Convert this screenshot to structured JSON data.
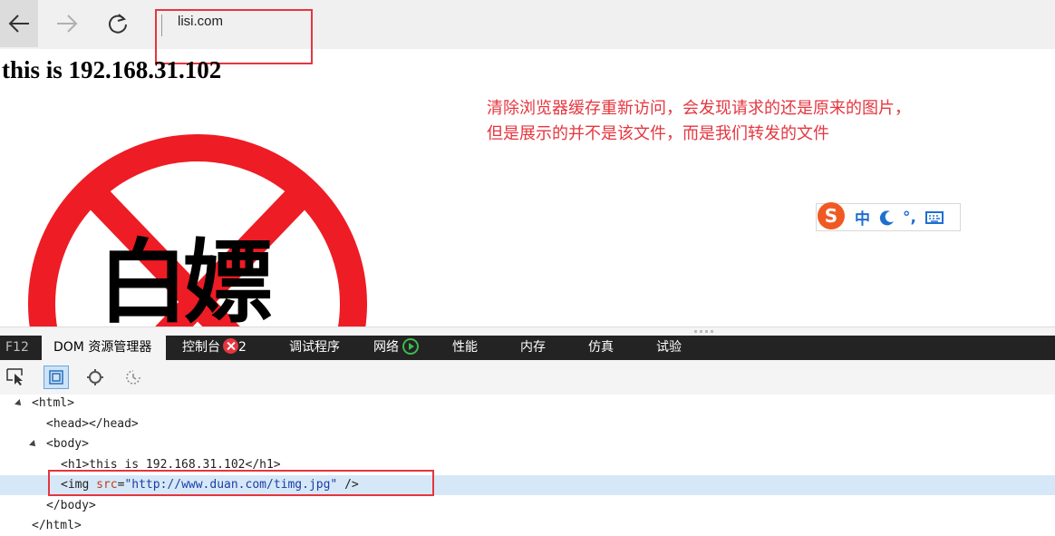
{
  "browser": {
    "url": "lisi.com"
  },
  "page": {
    "heading": "this is 192.168.31.102",
    "sign_text": "白嫖"
  },
  "annotation": {
    "line1": "清除浏览器缓存重新访问，会发现请求的还是原来的图片，",
    "line2": "但是展示的并不是该文件，而是我们转发的文件"
  },
  "ime": {
    "lang": "中",
    "punct": "°,"
  },
  "devtools": {
    "tabs": {
      "f12": "F12",
      "dom": "DOM 资源管理器",
      "console": "控制台",
      "console_errors": "2",
      "debugger": "调试程序",
      "network": "网络",
      "performance": "性能",
      "memory": "内存",
      "emulation": "仿真",
      "experiments": "试验"
    },
    "tree": {
      "html_open": "<html>",
      "head": "<head></head>",
      "body_open": "<body>",
      "h1": "<h1>this is 192.168.31.102</h1>",
      "img_open": "<img ",
      "img_attr_name": "src",
      "img_eq": "=",
      "img_attr_value": "\"http://www.duan.com/timg.jpg\"",
      "img_close": " />",
      "body_close": "</body>",
      "html_close": "</html>"
    }
  },
  "colors": {
    "annotation_red": "#e5363f",
    "sign_red": "#ee1c24",
    "selected_row": "#d6e8f7"
  }
}
